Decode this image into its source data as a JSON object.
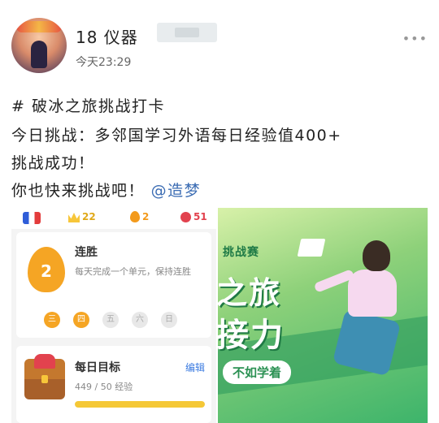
{
  "post": {
    "username": "18 仪器",
    "timestamp": "今天23:29",
    "more_icon": "more-dots-icon",
    "lines": [
      "# 破冰之旅挑战打卡",
      "今日挑战：多邻国学习外语每日经验值400+",
      "挑战成功！",
      "你也快来挑战吧！"
    ],
    "mention": "@造梦"
  },
  "app": {
    "flag_icon": "french-flag-icon",
    "crowns": "22",
    "streak_count": "2",
    "gems": "51",
    "streak": {
      "title": "连胜",
      "number": "2",
      "description": "每天完成一个单元，保持连胜",
      "days": [
        {
          "label": "三",
          "active": true
        },
        {
          "label": "四",
          "active": true
        },
        {
          "label": "五",
          "active": false
        },
        {
          "label": "六",
          "active": false
        },
        {
          "label": "日",
          "active": false
        }
      ]
    },
    "goal": {
      "title": "每日目标",
      "edit_label": "编辑",
      "progress_text": "449 / 50 经验",
      "progress_fraction": 1.0
    }
  },
  "banner": {
    "tag": "挑战赛",
    "title_line1": "之旅",
    "title_line2": "接力",
    "button": "不如学着"
  }
}
